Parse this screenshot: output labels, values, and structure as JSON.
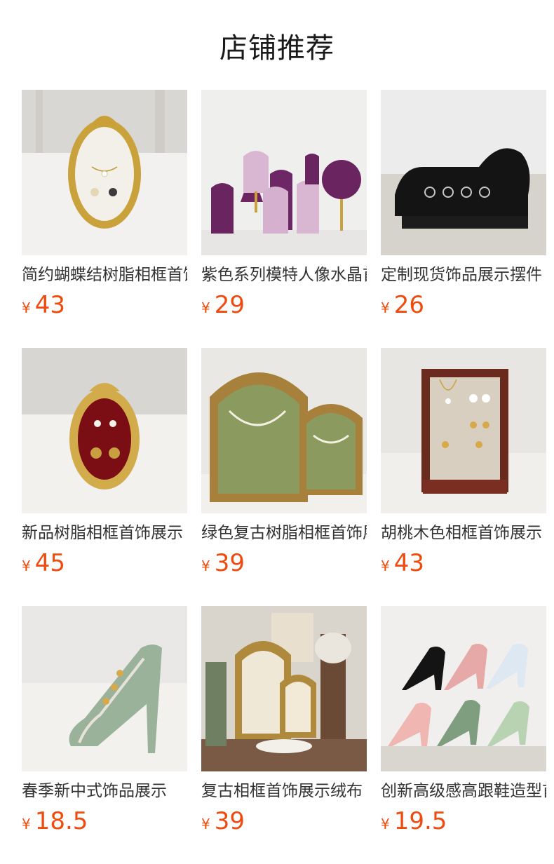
{
  "header": {
    "title": "店铺推荐"
  },
  "products": [
    {
      "name": "简约蝴蝶结树脂相框首饰展示",
      "currency": "¥",
      "price": "43",
      "image_icon": "gold-bow-oval-frame"
    },
    {
      "name": "紫色系列模特人像水晶首饰展示",
      "currency": "¥",
      "price": "29",
      "image_icon": "purple-mannequin-busts"
    },
    {
      "name": "定制现货饰品展示摆件",
      "currency": "¥",
      "price": "26",
      "image_icon": "black-sofa-ring-display"
    },
    {
      "name": "新品树脂相框首饰展示",
      "currency": "¥",
      "price": "45",
      "image_icon": "gold-oval-frame-red"
    },
    {
      "name": "绿色复古树脂相框首饰展示",
      "currency": "¥",
      "price": "39",
      "image_icon": "green-arched-frames"
    },
    {
      "name": "胡桃木色相框首饰展示",
      "currency": "¥",
      "price": "43",
      "image_icon": "walnut-board-frame"
    },
    {
      "name": "春季新中式饰品展示",
      "currency": "¥",
      "price": "18.5",
      "image_icon": "green-high-heel"
    },
    {
      "name": "复古相框首饰展示绒布",
      "currency": "¥",
      "price": "39",
      "image_icon": "vintage-display-set"
    },
    {
      "name": "创新高级感高跟鞋造型首饰展示",
      "currency": "¥",
      "price": "19.5",
      "image_icon": "high-heel-shoes"
    }
  ]
}
